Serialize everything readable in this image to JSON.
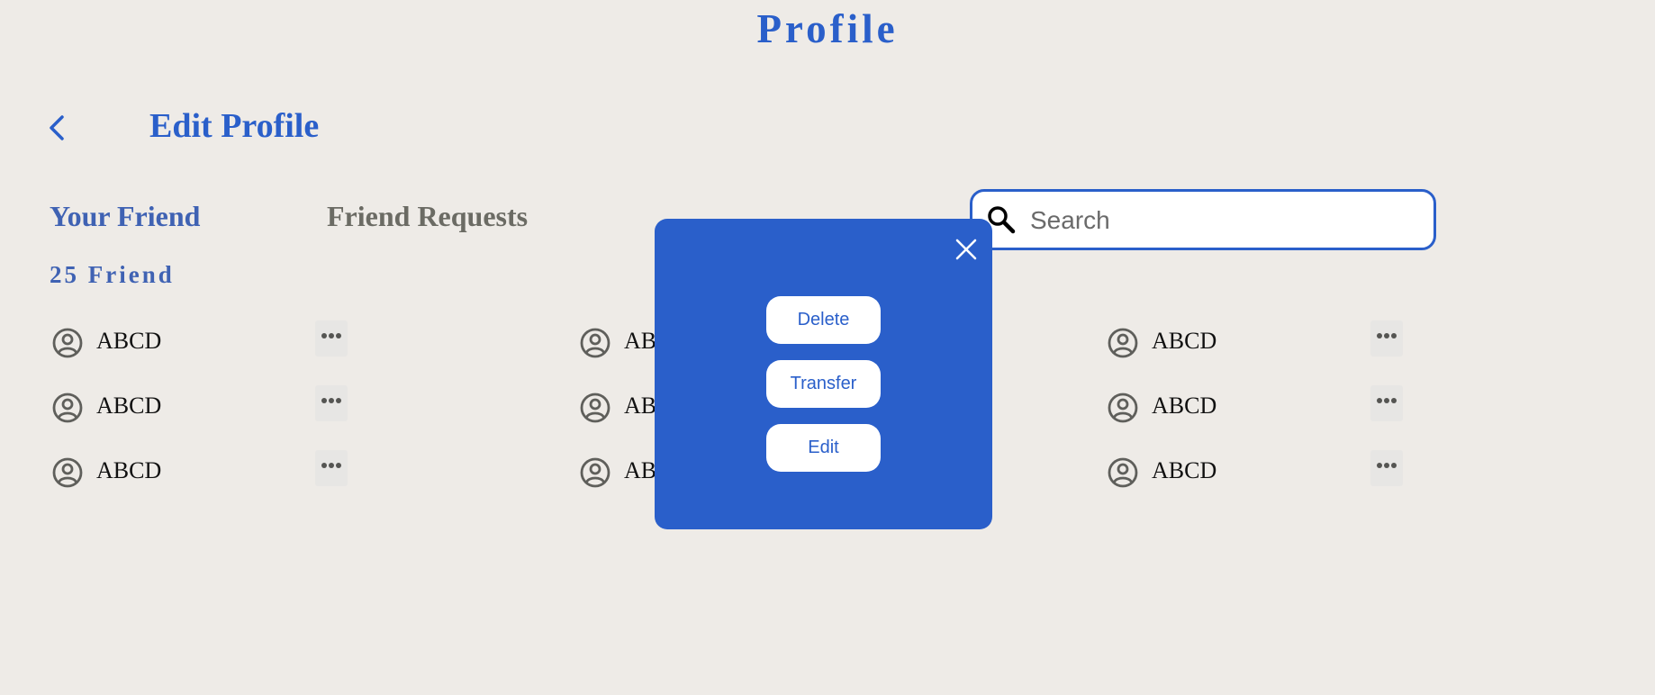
{
  "header": {
    "title": "Profile"
  },
  "subheader": {
    "title": "Edit Profile"
  },
  "tabs": {
    "friends": "Your Friend",
    "requests": "Friend Requests"
  },
  "friend_count": "25 Friend",
  "search": {
    "placeholder": "Search",
    "value": ""
  },
  "friends": [
    {
      "name": "ABCD"
    },
    {
      "name": "ABCD"
    },
    {
      "name": "ABCD"
    },
    {
      "name": "ABCD"
    },
    {
      "name": "ABCD"
    },
    {
      "name": "ABCD"
    },
    {
      "name": "ABCD"
    },
    {
      "name": "ABCD"
    },
    {
      "name": "ABCD"
    }
  ],
  "modal": {
    "delete_label": "Delete",
    "transfer_label": "Transfer",
    "edit_label": "Edit"
  },
  "icons": {
    "back": "chevron-left-icon",
    "search": "search-icon",
    "avatar": "user-circle-icon",
    "more": "more-horizontal-icon",
    "close": "close-icon"
  },
  "colors": {
    "accent": "#2a5fca",
    "background": "#eeebe7",
    "muted_tab": "#6b6b64"
  }
}
